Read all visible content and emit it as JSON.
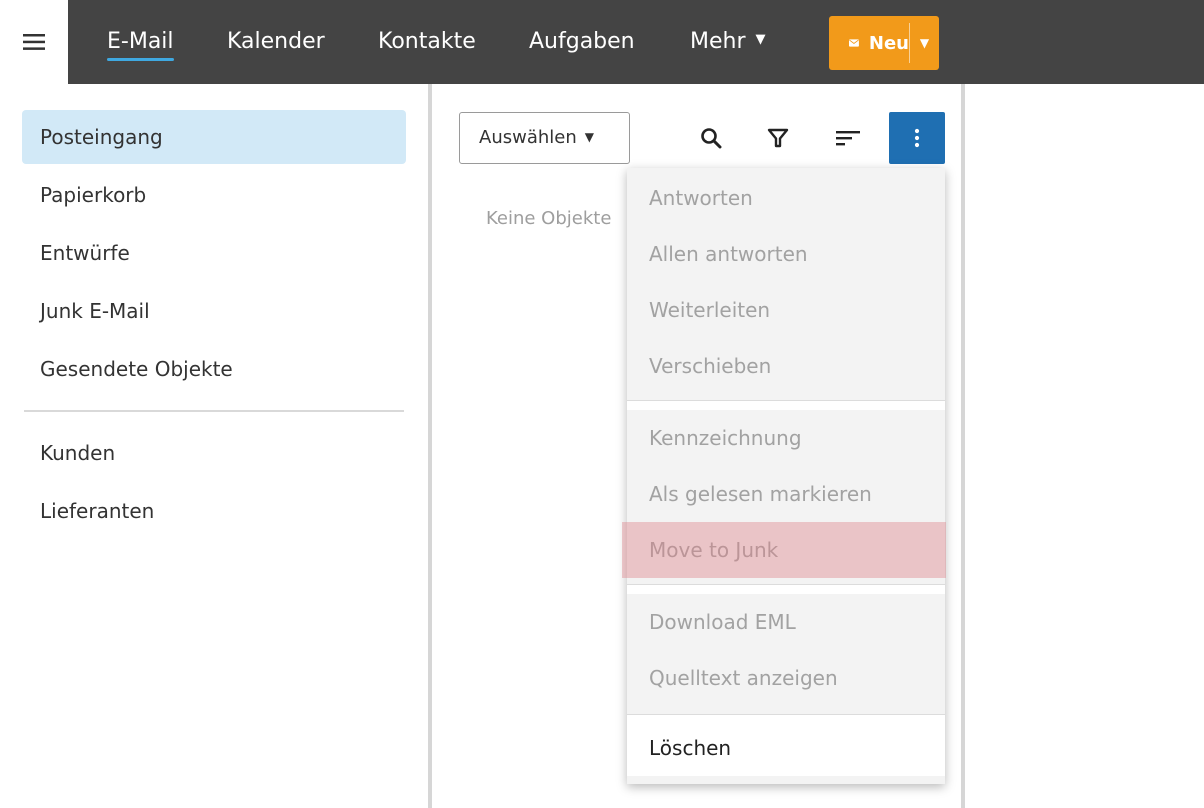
{
  "nav": {
    "items": [
      {
        "label": "E-Mail"
      },
      {
        "label": "Kalender"
      },
      {
        "label": "Kontakte"
      },
      {
        "label": "Aufgaben"
      },
      {
        "label": "Mehr"
      }
    ],
    "new_label": "Neu"
  },
  "sidebar": {
    "folders": [
      {
        "label": "Posteingang"
      },
      {
        "label": "Papierkorb"
      },
      {
        "label": "Entwürfe"
      },
      {
        "label": "Junk E-Mail"
      },
      {
        "label": "Gesendete Objekte"
      }
    ],
    "custom_folders": [
      {
        "label": "Kunden"
      },
      {
        "label": "Lieferanten"
      }
    ]
  },
  "list": {
    "select_label": "Auswählen",
    "empty_text": "Keine Objekte"
  },
  "menu": {
    "items": [
      {
        "label": "Antworten"
      },
      {
        "label": "Allen antworten"
      },
      {
        "label": "Weiterleiten"
      },
      {
        "label": "Verschieben"
      },
      {
        "label": "Kennzeichnung"
      },
      {
        "label": "Als gelesen markieren"
      },
      {
        "label": "Move to Junk"
      },
      {
        "label": "Download EML"
      },
      {
        "label": "Quelltext anzeigen"
      },
      {
        "label": "Löschen"
      }
    ]
  },
  "colors": {
    "topbar": "#444444",
    "accent_underline": "#3fa8e0",
    "new_button": "#f29a1a",
    "more_button": "#1f6fb2",
    "selected_folder": "#d2e9f7",
    "highlight": "#dd828a"
  },
  "icons": {
    "menu": "hamburger-icon",
    "new": "envelope-icon",
    "search": "search-icon",
    "filter": "filter-icon",
    "sort": "sort-icon",
    "more": "vertical-dots-icon"
  }
}
